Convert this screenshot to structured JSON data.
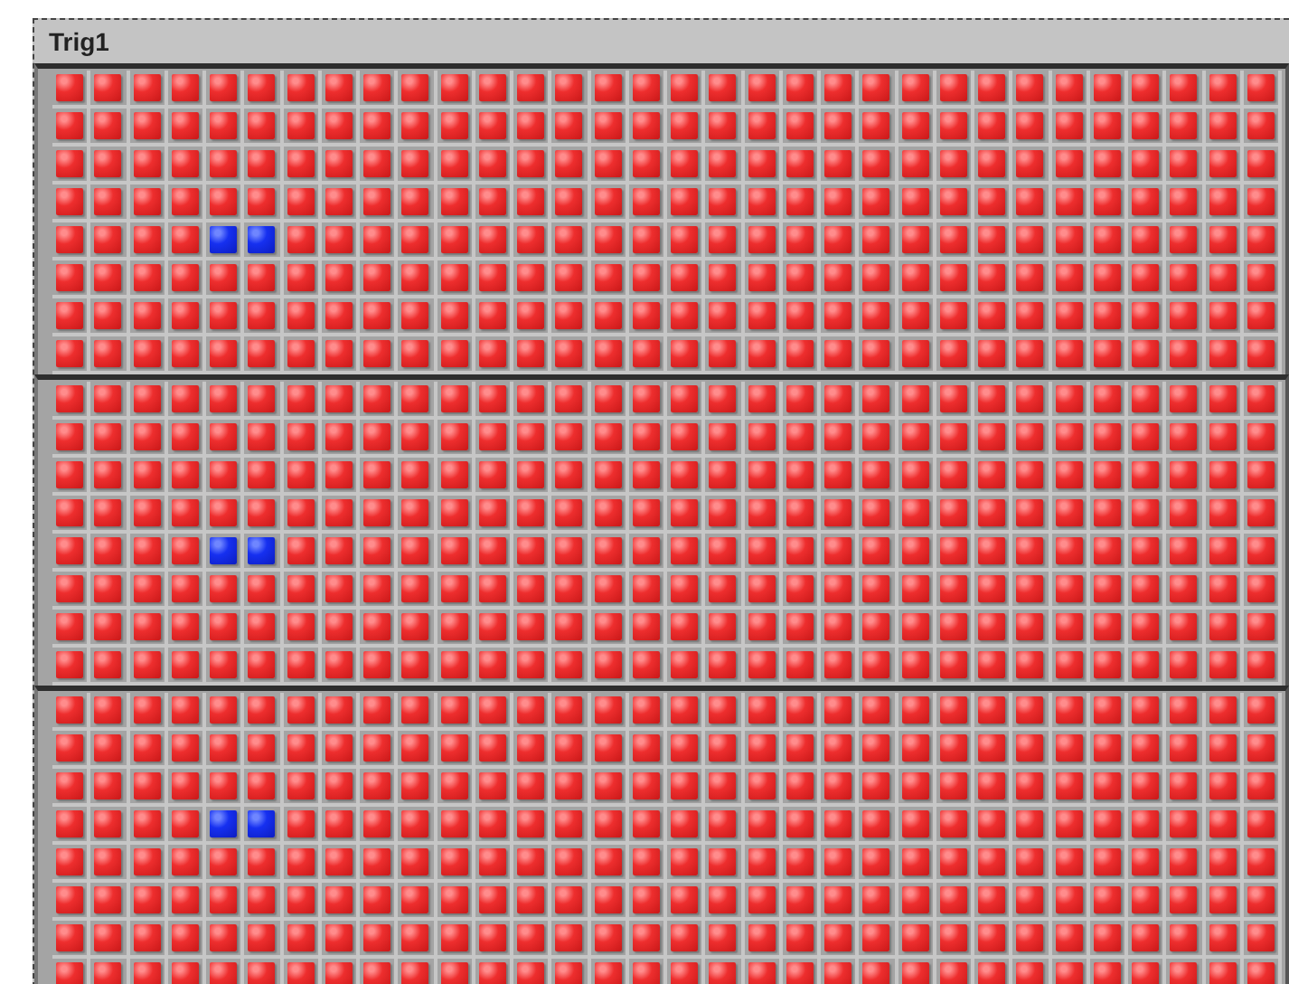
{
  "title": "Trig1",
  "panels": [
    {
      "rows": [
        [
          false,
          false,
          false,
          false,
          false,
          false,
          false,
          false,
          false,
          false,
          false,
          false,
          false,
          false,
          false,
          false,
          false,
          false,
          false,
          false,
          false,
          false,
          false,
          false,
          false,
          false,
          false,
          false,
          false,
          false,
          false,
          false
        ],
        [
          false,
          false,
          false,
          false,
          false,
          false,
          false,
          false,
          false,
          false,
          false,
          false,
          false,
          false,
          false,
          false,
          false,
          false,
          false,
          false,
          false,
          false,
          false,
          false,
          false,
          false,
          false,
          false,
          false,
          false,
          false,
          false
        ],
        [
          false,
          false,
          false,
          false,
          false,
          false,
          false,
          false,
          false,
          false,
          false,
          false,
          false,
          false,
          false,
          false,
          false,
          false,
          false,
          false,
          false,
          false,
          false,
          false,
          false,
          false,
          false,
          false,
          false,
          false,
          false,
          false
        ],
        [
          false,
          false,
          false,
          false,
          false,
          false,
          false,
          false,
          false,
          false,
          false,
          false,
          false,
          false,
          false,
          false,
          false,
          false,
          false,
          false,
          false,
          false,
          false,
          false,
          false,
          false,
          false,
          false,
          false,
          false,
          false,
          false
        ],
        [
          false,
          false,
          false,
          false,
          true,
          true,
          false,
          false,
          false,
          false,
          false,
          false,
          false,
          false,
          false,
          false,
          false,
          false,
          false,
          false,
          false,
          false,
          false,
          false,
          false,
          false,
          false,
          false,
          false,
          false,
          false,
          false
        ],
        [
          false,
          false,
          false,
          false,
          false,
          false,
          false,
          false,
          false,
          false,
          false,
          false,
          false,
          false,
          false,
          false,
          false,
          false,
          false,
          false,
          false,
          false,
          false,
          false,
          false,
          false,
          false,
          false,
          false,
          false,
          false,
          false
        ],
        [
          false,
          false,
          false,
          false,
          false,
          false,
          false,
          false,
          false,
          false,
          false,
          false,
          false,
          false,
          false,
          false,
          false,
          false,
          false,
          false,
          false,
          false,
          false,
          false,
          false,
          false,
          false,
          false,
          false,
          false,
          false,
          false
        ],
        [
          false,
          false,
          false,
          false,
          false,
          false,
          false,
          false,
          false,
          false,
          false,
          false,
          false,
          false,
          false,
          false,
          false,
          false,
          false,
          false,
          false,
          false,
          false,
          false,
          false,
          false,
          false,
          false,
          false,
          false,
          false,
          false
        ]
      ]
    },
    {
      "rows": [
        [
          false,
          false,
          false,
          false,
          false,
          false,
          false,
          false,
          false,
          false,
          false,
          false,
          false,
          false,
          false,
          false,
          false,
          false,
          false,
          false,
          false,
          false,
          false,
          false,
          false,
          false,
          false,
          false,
          false,
          false,
          false,
          false
        ],
        [
          false,
          false,
          false,
          false,
          false,
          false,
          false,
          false,
          false,
          false,
          false,
          false,
          false,
          false,
          false,
          false,
          false,
          false,
          false,
          false,
          false,
          false,
          false,
          false,
          false,
          false,
          false,
          false,
          false,
          false,
          false,
          false
        ],
        [
          false,
          false,
          false,
          false,
          false,
          false,
          false,
          false,
          false,
          false,
          false,
          false,
          false,
          false,
          false,
          false,
          false,
          false,
          false,
          false,
          false,
          false,
          false,
          false,
          false,
          false,
          false,
          false,
          false,
          false,
          false,
          false
        ],
        [
          false,
          false,
          false,
          false,
          false,
          false,
          false,
          false,
          false,
          false,
          false,
          false,
          false,
          false,
          false,
          false,
          false,
          false,
          false,
          false,
          false,
          false,
          false,
          false,
          false,
          false,
          false,
          false,
          false,
          false,
          false,
          false
        ],
        [
          false,
          false,
          false,
          false,
          true,
          true,
          false,
          false,
          false,
          false,
          false,
          false,
          false,
          false,
          false,
          false,
          false,
          false,
          false,
          false,
          false,
          false,
          false,
          false,
          false,
          false,
          false,
          false,
          false,
          false,
          false,
          false
        ],
        [
          false,
          false,
          false,
          false,
          false,
          false,
          false,
          false,
          false,
          false,
          false,
          false,
          false,
          false,
          false,
          false,
          false,
          false,
          false,
          false,
          false,
          false,
          false,
          false,
          false,
          false,
          false,
          false,
          false,
          false,
          false,
          false
        ],
        [
          false,
          false,
          false,
          false,
          false,
          false,
          false,
          false,
          false,
          false,
          false,
          false,
          false,
          false,
          false,
          false,
          false,
          false,
          false,
          false,
          false,
          false,
          false,
          false,
          false,
          false,
          false,
          false,
          false,
          false,
          false,
          false
        ],
        [
          false,
          false,
          false,
          false,
          false,
          false,
          false,
          false,
          false,
          false,
          false,
          false,
          false,
          false,
          false,
          false,
          false,
          false,
          false,
          false,
          false,
          false,
          false,
          false,
          false,
          false,
          false,
          false,
          false,
          false,
          false,
          false
        ]
      ]
    },
    {
      "rows": [
        [
          false,
          false,
          false,
          false,
          false,
          false,
          false,
          false,
          false,
          false,
          false,
          false,
          false,
          false,
          false,
          false,
          false,
          false,
          false,
          false,
          false,
          false,
          false,
          false,
          false,
          false,
          false,
          false,
          false,
          false,
          false,
          false
        ],
        [
          false,
          false,
          false,
          false,
          false,
          false,
          false,
          false,
          false,
          false,
          false,
          false,
          false,
          false,
          false,
          false,
          false,
          false,
          false,
          false,
          false,
          false,
          false,
          false,
          false,
          false,
          false,
          false,
          false,
          false,
          false,
          false
        ],
        [
          false,
          false,
          false,
          false,
          false,
          false,
          false,
          false,
          false,
          false,
          false,
          false,
          false,
          false,
          false,
          false,
          false,
          false,
          false,
          false,
          false,
          false,
          false,
          false,
          false,
          false,
          false,
          false,
          false,
          false,
          false,
          false
        ],
        [
          false,
          false,
          false,
          false,
          true,
          true,
          false,
          false,
          false,
          false,
          false,
          false,
          false,
          false,
          false,
          false,
          false,
          false,
          false,
          false,
          false,
          false,
          false,
          false,
          false,
          false,
          false,
          false,
          false,
          false,
          false,
          false
        ],
        [
          false,
          false,
          false,
          false,
          false,
          false,
          false,
          false,
          false,
          false,
          false,
          false,
          false,
          false,
          false,
          false,
          false,
          false,
          false,
          false,
          false,
          false,
          false,
          false,
          false,
          false,
          false,
          false,
          false,
          false,
          false,
          false
        ],
        [
          false,
          false,
          false,
          false,
          false,
          false,
          false,
          false,
          false,
          false,
          false,
          false,
          false,
          false,
          false,
          false,
          false,
          false,
          false,
          false,
          false,
          false,
          false,
          false,
          false,
          false,
          false,
          false,
          false,
          false,
          false,
          false
        ],
        [
          false,
          false,
          false,
          false,
          false,
          false,
          false,
          false,
          false,
          false,
          false,
          false,
          false,
          false,
          false,
          false,
          false,
          false,
          false,
          false,
          false,
          false,
          false,
          false,
          false,
          false,
          false,
          false,
          false,
          false,
          false,
          false
        ],
        [
          false,
          false,
          false,
          false,
          false,
          false,
          false,
          false,
          false,
          false,
          false,
          false,
          false,
          false,
          false,
          false,
          false,
          false,
          false,
          false,
          false,
          false,
          false,
          false,
          false,
          false,
          false,
          false,
          false,
          false,
          false,
          false
        ]
      ]
    }
  ]
}
